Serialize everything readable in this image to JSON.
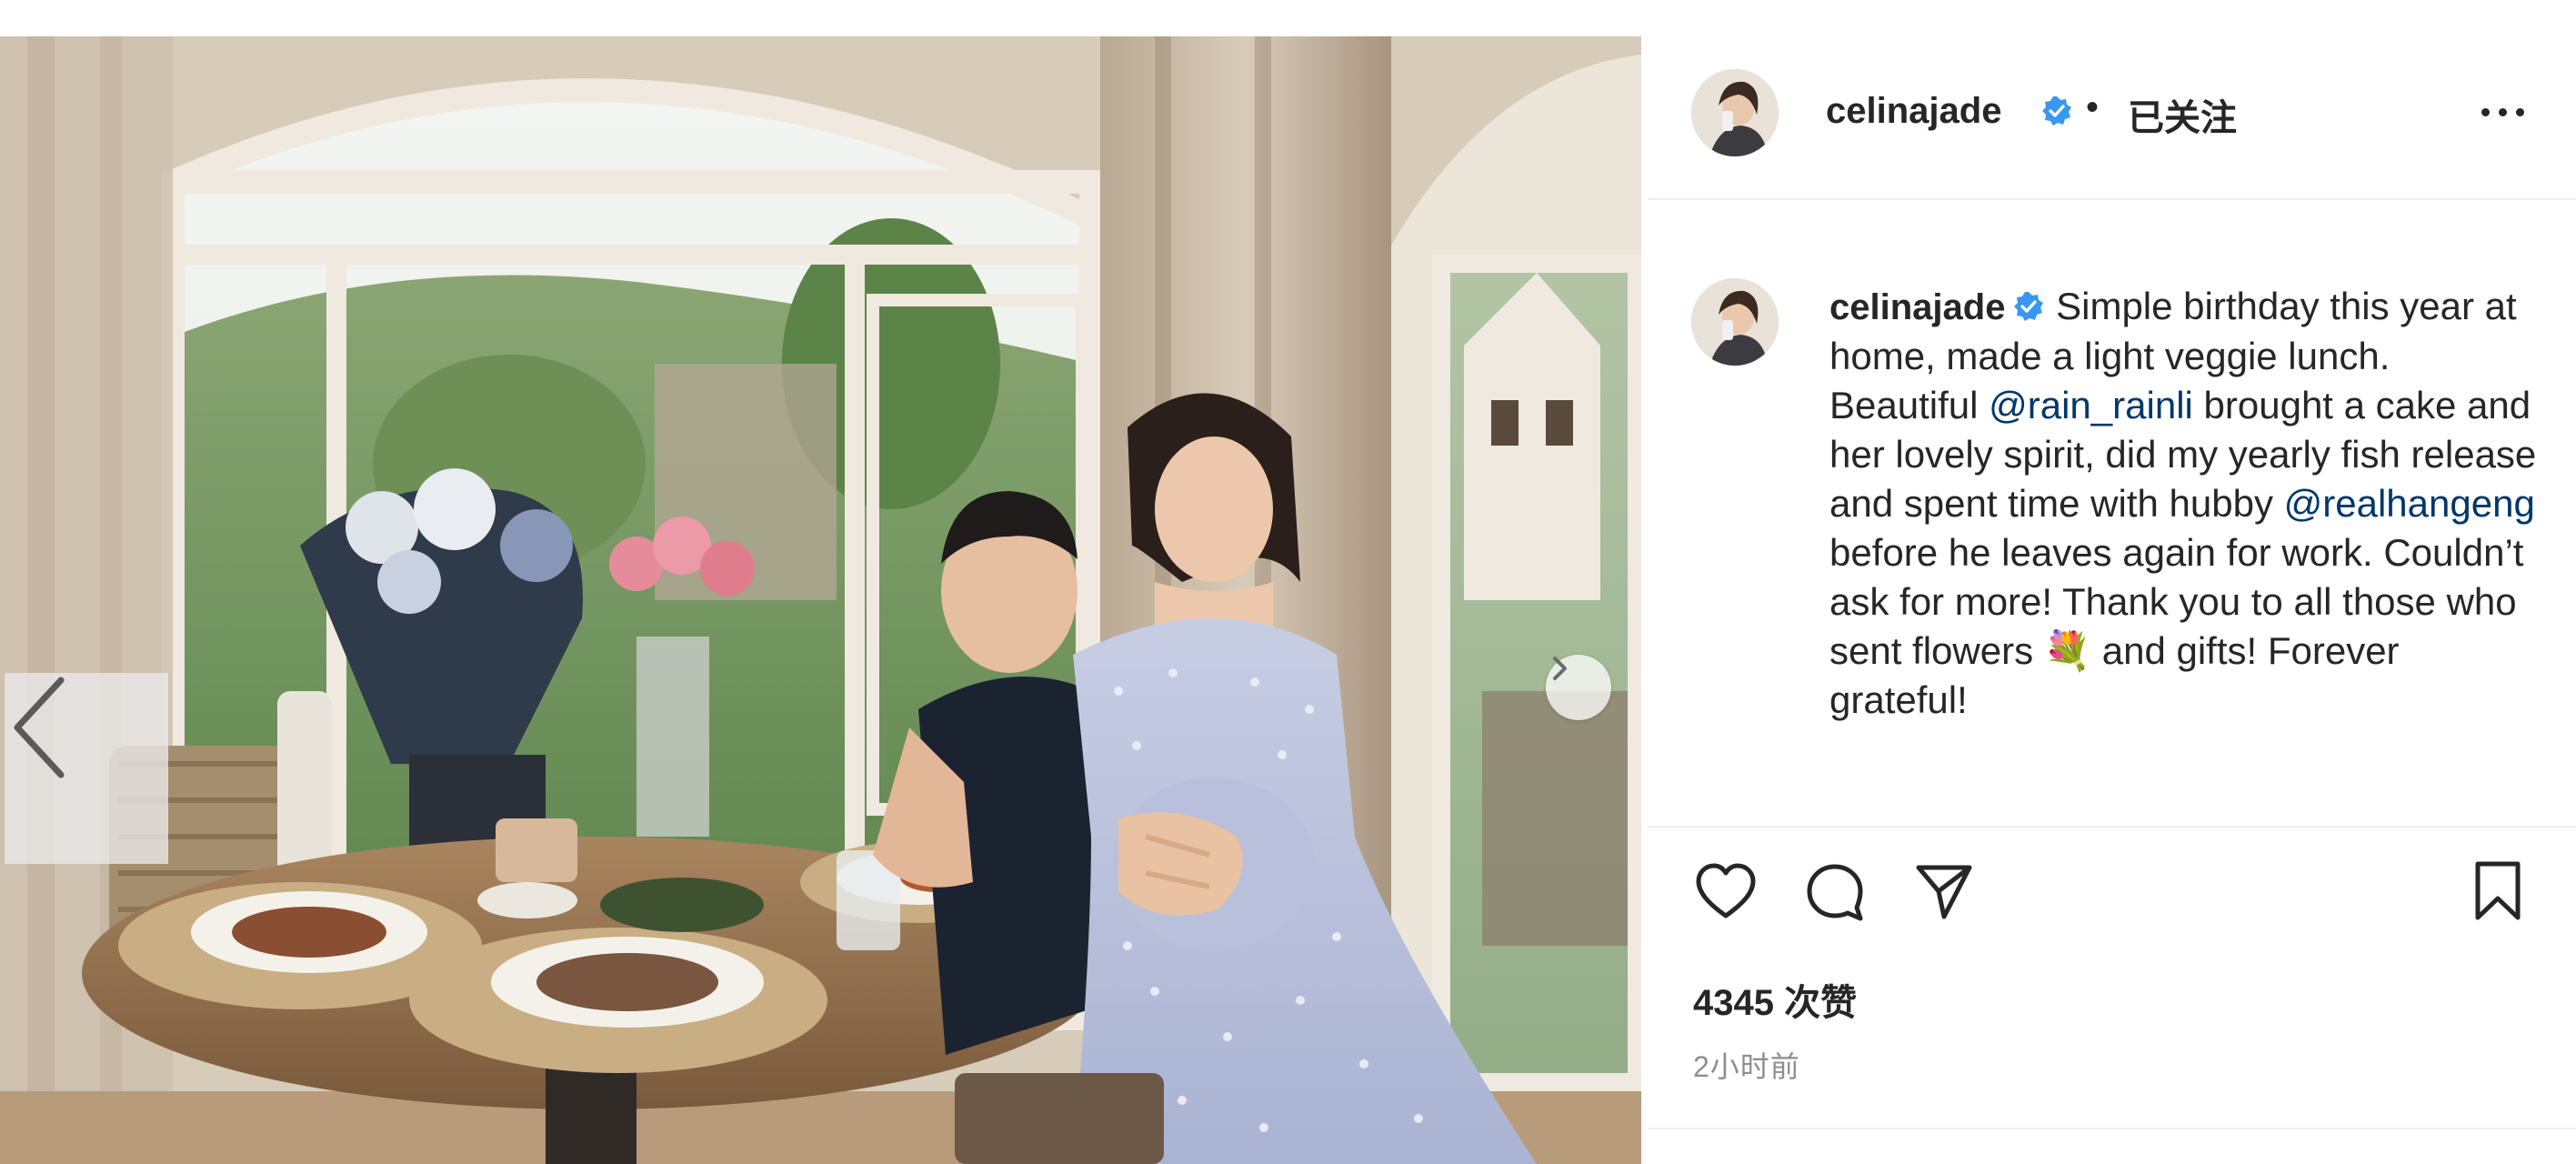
{
  "post": {
    "author": "celinajade",
    "follow_state": "已关注",
    "separator": "•",
    "caption": {
      "username": "celinajade",
      "part1": "Simple birthday this year at home, made a light veggie lunch. Beautiful ",
      "mention1": "@rain_rainli",
      "part2": " brought a cake and her lovely spirit, did my yearly fish release and spent time with hubby ",
      "mention2": "@realhangeng",
      "part3": " before he leaves again for work. Couldn’t ask for more! Thank you to all those who sent flowers ",
      "emoji": "💐",
      "part4": "  and gifts! Forever grateful!"
    },
    "likes": "4345 次赞",
    "time_ago": "2小时前"
  },
  "icons": {
    "verified": "verified-badge-icon",
    "more": "more-options-icon",
    "like": "heart-icon",
    "comment": "comment-icon",
    "share": "paper-plane-icon",
    "save": "bookmark-icon",
    "prev": "chevron-left-icon",
    "next": "chevron-right-icon"
  },
  "colors": {
    "verified_blue": "#3897f0",
    "text": "#262626",
    "muted": "#8e8e8e",
    "mention": "#00376b"
  }
}
